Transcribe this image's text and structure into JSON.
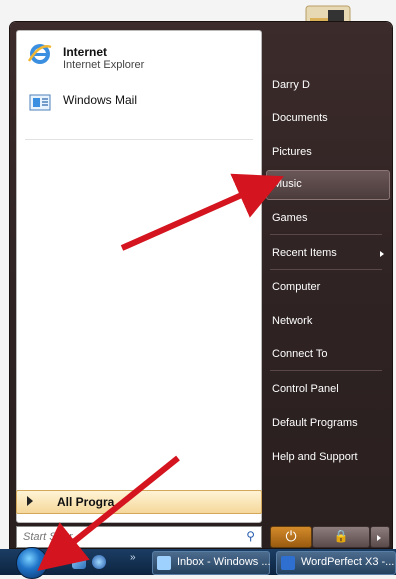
{
  "start_menu": {
    "pinned": [
      {
        "title": "Internet",
        "subtitle": "Internet Explorer",
        "icon": "internet-explorer-icon"
      },
      {
        "title": "Windows Mail",
        "subtitle": "",
        "icon": "windows-mail-icon"
      }
    ],
    "all_programs": "All Progra",
    "search_placeholder": "Start Sear",
    "right": {
      "items": [
        {
          "label": "Darry D"
        },
        {
          "label": "Documents"
        },
        {
          "label": "Pictures"
        },
        {
          "label": "Music"
        },
        {
          "label": "Games"
        },
        {
          "label": "Recent Items"
        },
        {
          "label": "Computer"
        },
        {
          "label": "Network"
        },
        {
          "label": "Connect To"
        },
        {
          "label": "Control Panel"
        },
        {
          "label": "Default Programs"
        },
        {
          "label": "Help and Support"
        }
      ]
    }
  },
  "taskbar": {
    "tasks": [
      {
        "label": "Inbox - Windows ...",
        "icon": "mail-icon"
      },
      {
        "label": "WordPerfect X3 -...",
        "icon": "wordperfect-icon"
      }
    ]
  },
  "colors": {
    "menu_bg": "#2f2323",
    "highlight": "#4b3c3c",
    "arrow": "#d4141e",
    "taskbar": "#0d2440",
    "all_programs_bg": "#f5d79a"
  }
}
